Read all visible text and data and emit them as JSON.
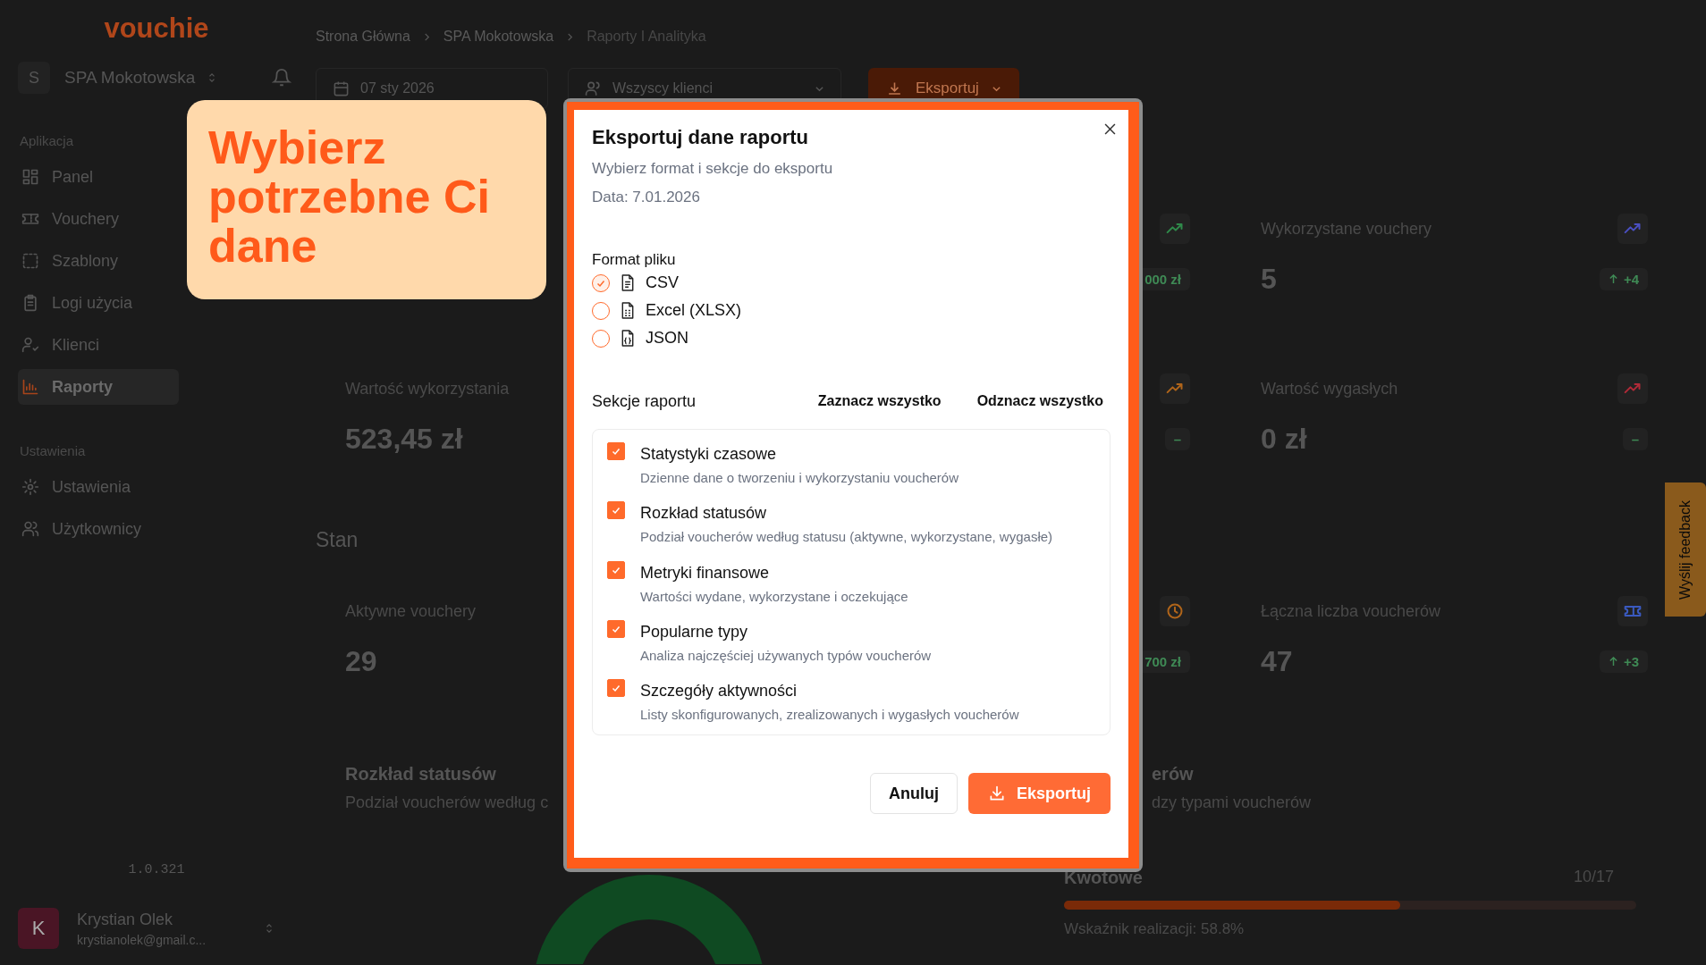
{
  "brand": {
    "logo": "vouchie"
  },
  "org": {
    "initial": "S",
    "name": "SPA Mokotowska"
  },
  "sidebar": {
    "sections": [
      {
        "title": "Aplikacja",
        "items": [
          {
            "label": "Panel",
            "selected": false
          },
          {
            "label": "Vouchery",
            "selected": false
          },
          {
            "label": "Szablony",
            "selected": false
          },
          {
            "label": "Logi użycia",
            "selected": false
          },
          {
            "label": "Klienci",
            "selected": false
          },
          {
            "label": "Raporty",
            "selected": true
          }
        ]
      },
      {
        "title": "Ustawienia",
        "items": [
          {
            "label": "Ustawienia",
            "selected": false
          },
          {
            "label": "Użytkownicy",
            "selected": false
          }
        ]
      }
    ],
    "version": "1.0.321"
  },
  "user": {
    "initial": "K",
    "name": "Krystian Olek",
    "email": "krystianolek@gmail.c..."
  },
  "breadcrumb": [
    "Strona Główna",
    "SPA Mokotowska",
    "Raporty I Analityka"
  ],
  "toolbar": {
    "date": "07 sty 2026",
    "client_filter": "Wszyscy klienci",
    "export_button": "Eksportuj"
  },
  "stat_rows": [
    {
      "cards": [
        {
          "color": "#2f8a4a",
          "badge": {
            "text": "000 zł",
            "trend_up": false
          }
        },
        {
          "label": "Wykorzystane vouchery",
          "value": "5",
          "color": "#4a4fc0",
          "badge": {
            "text": "+4",
            "trend_up": true
          }
        }
      ]
    },
    {
      "cards": [
        {
          "label": "Wartość wykorzystania",
          "value": "523,45 zł"
        },
        {
          "color": "#b0651a",
          "badge": {
            "text": "–",
            "trend_up": false
          }
        },
        {
          "label": "Wartość wygasłych",
          "value": "0 zł",
          "color": "#b02a38",
          "badge": {
            "text": "–",
            "trend_up": false
          }
        }
      ]
    }
  ],
  "section_heading": "Stan",
  "stat_rows_2": [
    {
      "cards": [
        {
          "label": "Aktywne vouchery",
          "value": "29"
        },
        {
          "color": "#b0651a",
          "badge": {
            "text": "700 zł",
            "trend_up": false
          }
        },
        {
          "label": "Łączna liczba voucherów",
          "value": "47",
          "color": "#3a5ac0",
          "badge": {
            "text": "+3",
            "trend_up": true
          }
        }
      ]
    }
  ],
  "charts": [
    {
      "title": "Rozkład statusów",
      "subtitle": "Podział voucherów według c"
    },
    {
      "title": "erów",
      "subtitle": "dzy typami voucherów",
      "progress": {
        "label": "Kwotowe",
        "count": "10/17",
        "level": 0.588,
        "caption": "Wskaźnik realizacji: 58.8%"
      }
    }
  ],
  "feedback_tab": "Wyślij feedback",
  "callout": {
    "text": "Wybierz potrzebne Ci dane"
  },
  "export_dialog": {
    "title": "Eksportuj dane raportu",
    "subtitle": "Wybierz format i sekcje do eksportu",
    "date": "Data: 7.01.2026",
    "format_label": "Format pliku",
    "formats": [
      {
        "label": "CSV",
        "selected": true
      },
      {
        "label": "Excel (XLSX)",
        "selected": false
      },
      {
        "label": "JSON",
        "selected": false
      }
    ],
    "sections_label": "Sekcje raportu",
    "select_all": "Zaznacz wszystko",
    "deselect_all": "Odznacz wszystko",
    "sections": [
      {
        "title": "Statystyki czasowe",
        "description": "Dzienne dane o tworzeniu i wykorzystaniu voucherów",
        "checked": true
      },
      {
        "title": "Rozkład statusów",
        "description": "Podział voucherów według statusu (aktywne, wykorzystane, wygasłe)",
        "checked": true
      },
      {
        "title": "Metryki finansowe",
        "description": "Wartości wydane, wykorzystane i oczekujące",
        "checked": true
      },
      {
        "title": "Popularne typy",
        "description": "Analiza najczęściej używanych typów voucherów",
        "checked": true
      },
      {
        "title": "Szczegóły aktywności",
        "description": "Listy skonfigurowanych, zrealizowanych i wygasłych voucherów",
        "checked": true
      }
    ],
    "cancel": "Anuluj",
    "export": "Eksportuj"
  }
}
